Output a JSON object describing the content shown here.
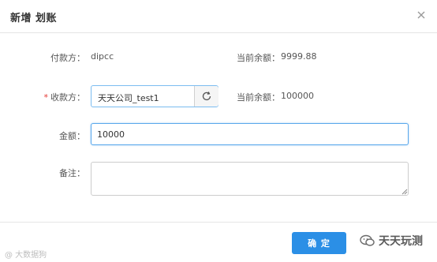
{
  "dialog": {
    "title": "新增 划账",
    "close_icon": "close-icon"
  },
  "form": {
    "payer": {
      "label": "付款方：",
      "value": "dipcc"
    },
    "payer_balance": {
      "label": "当前余额：",
      "value": "9999.88"
    },
    "payee": {
      "required_mark": "*",
      "label": "收款方：",
      "value": "天天公司_test1",
      "refresh_icon": "refresh-icon"
    },
    "payee_balance": {
      "label": "当前余额：",
      "value": "100000"
    },
    "amount": {
      "label": "金额：",
      "value": "10000"
    },
    "note": {
      "label": "备注：",
      "value": ""
    }
  },
  "footer": {
    "confirm_label": "确 定"
  },
  "watermarks": {
    "left": "@ 大数据狗",
    "right": "天天玩测"
  },
  "colors": {
    "primary": "#2b8fe6",
    "required": "#e53935",
    "focus_border": "#5aa8ec"
  }
}
